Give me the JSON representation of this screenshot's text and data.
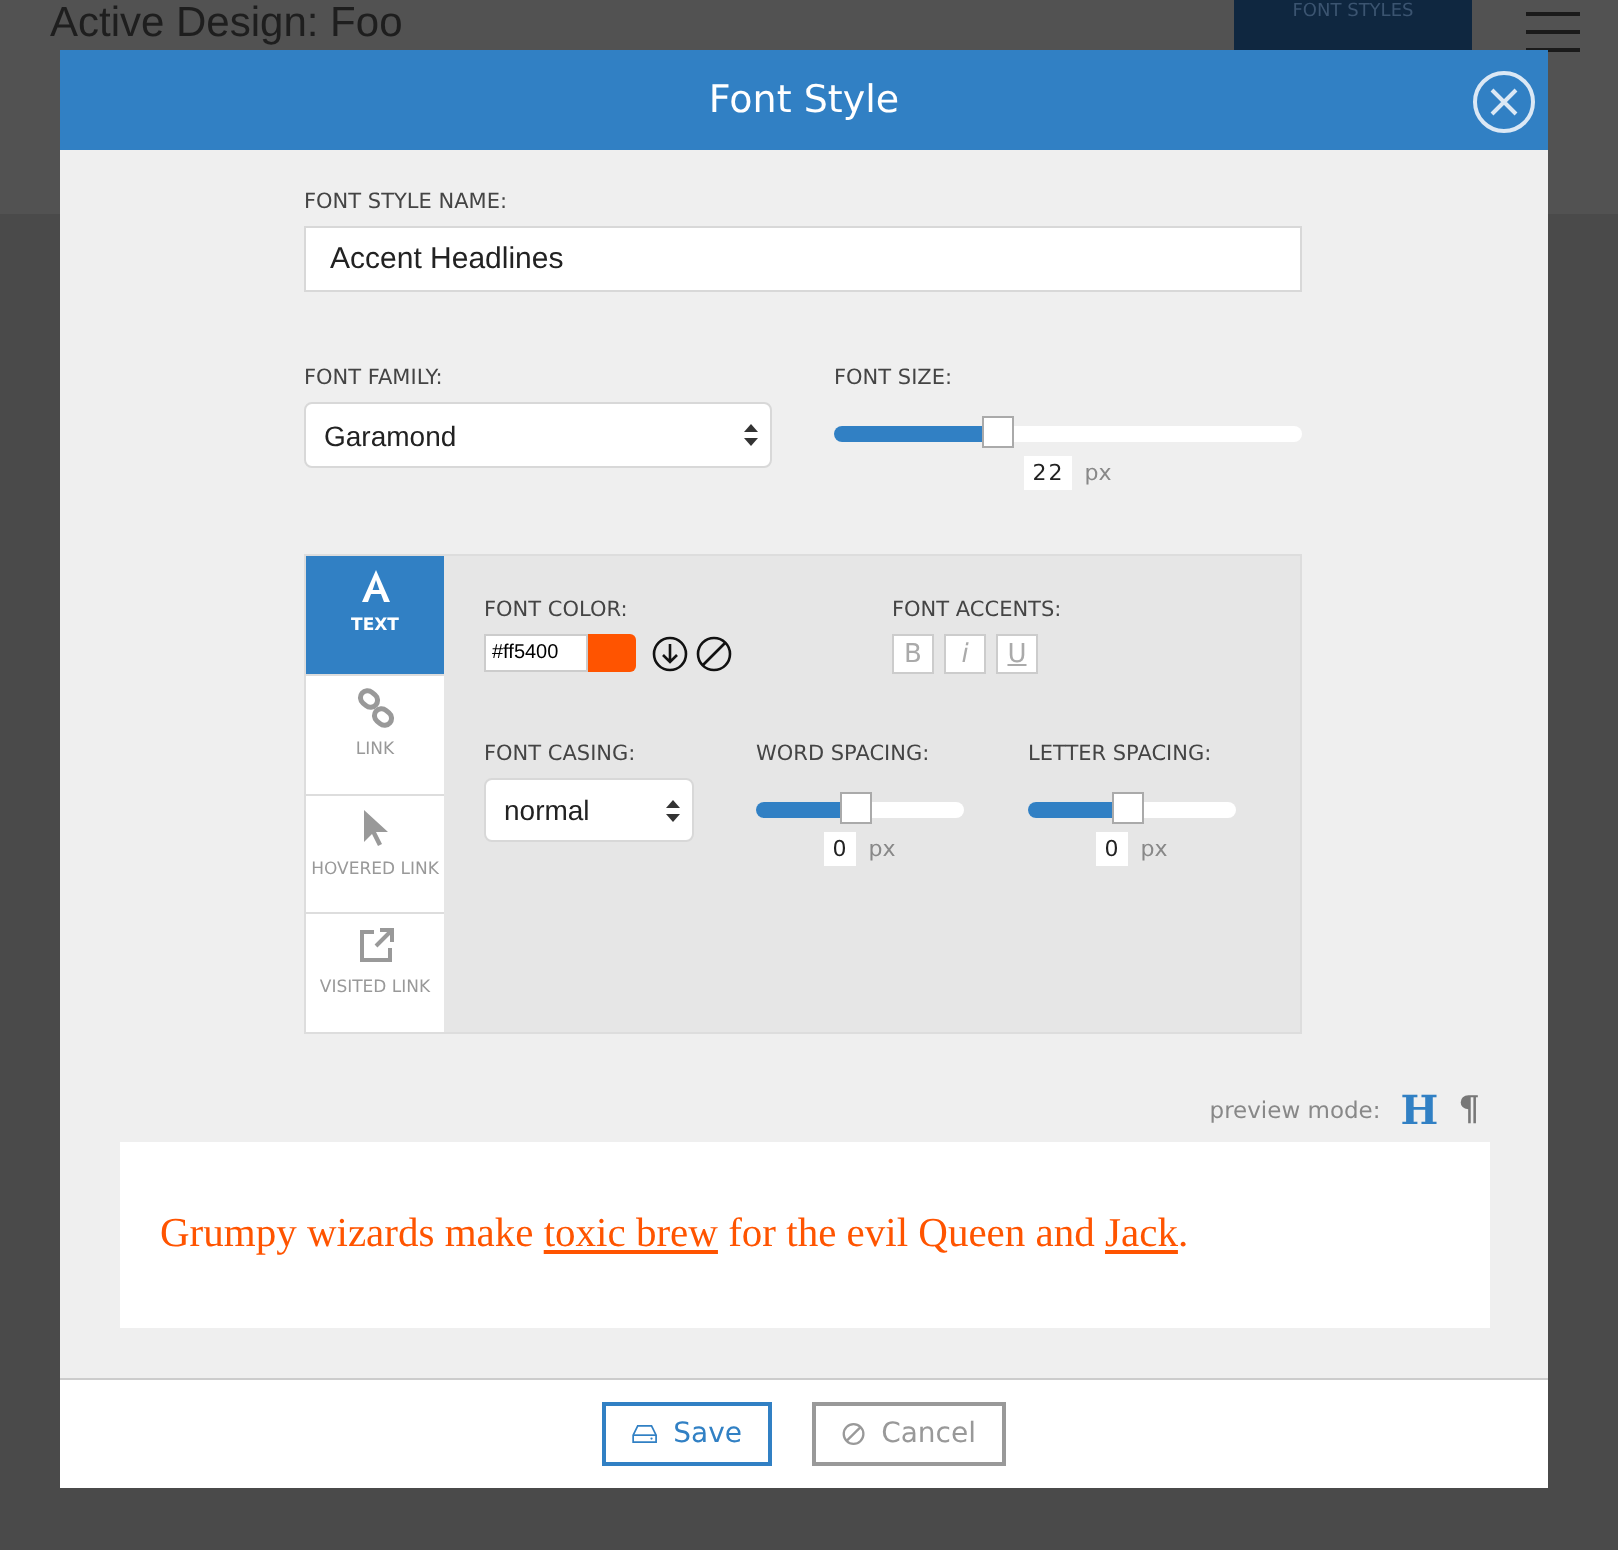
{
  "background": {
    "title": "Active Design: Foo",
    "font_styles_button": "FONT STYLES"
  },
  "dialog": {
    "title": "Font Style",
    "style_name": {
      "label": "FONT STYLE NAME:",
      "value": "Accent Headlines"
    },
    "font_family": {
      "label": "FONT FAMILY:",
      "value": "Garamond"
    },
    "font_size": {
      "label": "FONT SIZE:",
      "level": 0.35,
      "value": "22",
      "unit": "px"
    },
    "tabs": [
      {
        "label": "TEXT",
        "kind": "text",
        "selected": true
      },
      {
        "label": "LINK",
        "kind": "link",
        "selected": false
      },
      {
        "label": "HOVERED LINK",
        "kind": "pointer",
        "selected": false
      },
      {
        "label": "VISITED LINK",
        "kind": "external",
        "selected": false
      }
    ],
    "font_color": {
      "label": "FONT COLOR:",
      "value": "#ff5400",
      "color": "#ff5400"
    },
    "font_accents": {
      "label": "FONT ACCENTS:",
      "buttons": [
        {
          "label": "B",
          "kind": "bold",
          "on": false
        },
        {
          "label": "i",
          "kind": "italic",
          "on": false
        },
        {
          "label": "U",
          "kind": "underline",
          "on": false
        }
      ]
    },
    "font_casing": {
      "label": "FONT CASING:",
      "value": "normal"
    },
    "spacing": [
      {
        "label": "WORD SPACING:",
        "level": 0.48,
        "value": "0",
        "unit": "px"
      },
      {
        "label": "LETTER SPACING:",
        "level": 0.48,
        "value": "0",
        "unit": "px"
      }
    ],
    "preview_mode": {
      "label": "preview mode:",
      "options": [
        {
          "label": "H",
          "selected": true
        },
        {
          "label": "¶",
          "selected": false
        }
      ]
    },
    "preview": [
      {
        "text": "Grumpy wizards make ",
        "kind": "plain"
      },
      {
        "text": "toxic brew",
        "kind": "link"
      },
      {
        "text": " for the evil Queen and ",
        "kind": "plain"
      },
      {
        "text": "Jack",
        "kind": "link"
      },
      {
        "text": ".",
        "kind": "plain"
      }
    ],
    "buttons": [
      {
        "label": "Save",
        "kind": "save"
      },
      {
        "label": "Cancel",
        "kind": "cancel"
      }
    ]
  }
}
